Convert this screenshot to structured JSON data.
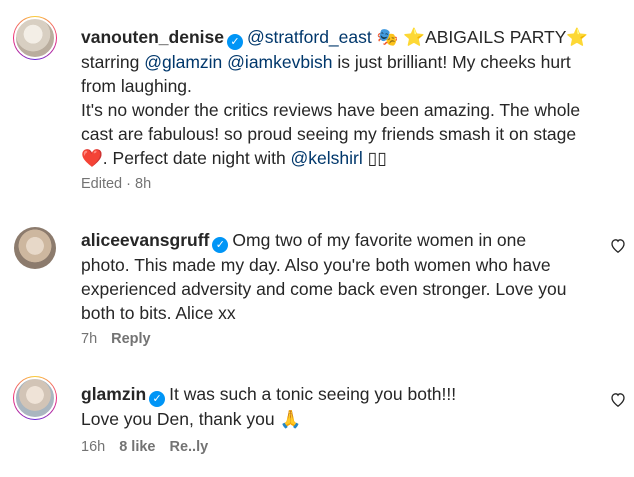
{
  "comments": [
    {
      "username": "vanouten_denise",
      "mention1": "@stratford_east",
      "text1a": "⭐ABIGAILS PARTY⭐",
      "text2a": "starring ",
      "mention2": "@glamzin",
      "mention3": "@iamkevbish",
      "text2b": " is just brilliant! My cheeks hurt",
      "text3": "from laughing.",
      "text4": "It's no wonder the critics reviews have been amazing. The whole",
      "text5": "cast are fabulous! so proud seeing my friends smash it on stage",
      "text6a": ". Perfect date night with ",
      "mention4": "@kelshirl",
      "text6b": " ▯▯",
      "time": "Edited · 8h"
    },
    {
      "username": "aliceevansgruff",
      "line1": "Omg two of my favorite women in one",
      "line2": "photo. This made my day. Also you're both women who have",
      "line3": "experienced adversity and come back even stronger. Love you",
      "line4": "both to bits. Alice xx",
      "time": "7h",
      "reply": "Reply"
    },
    {
      "username": "glamzin",
      "line1": "It was such a tonic seeing you both!!!",
      "line2": "Love you Den, thank you 🙏",
      "time": "16h",
      "likes": "8 like",
      "reply": "Re..ly"
    }
  ],
  "icons": {
    "verified": "verified-badge-icon",
    "heart": "heart-outline-icon"
  },
  "colors": {
    "verified": "#0095f6",
    "mention": "#00376b",
    "meta": "#737373",
    "text": "#262626"
  }
}
